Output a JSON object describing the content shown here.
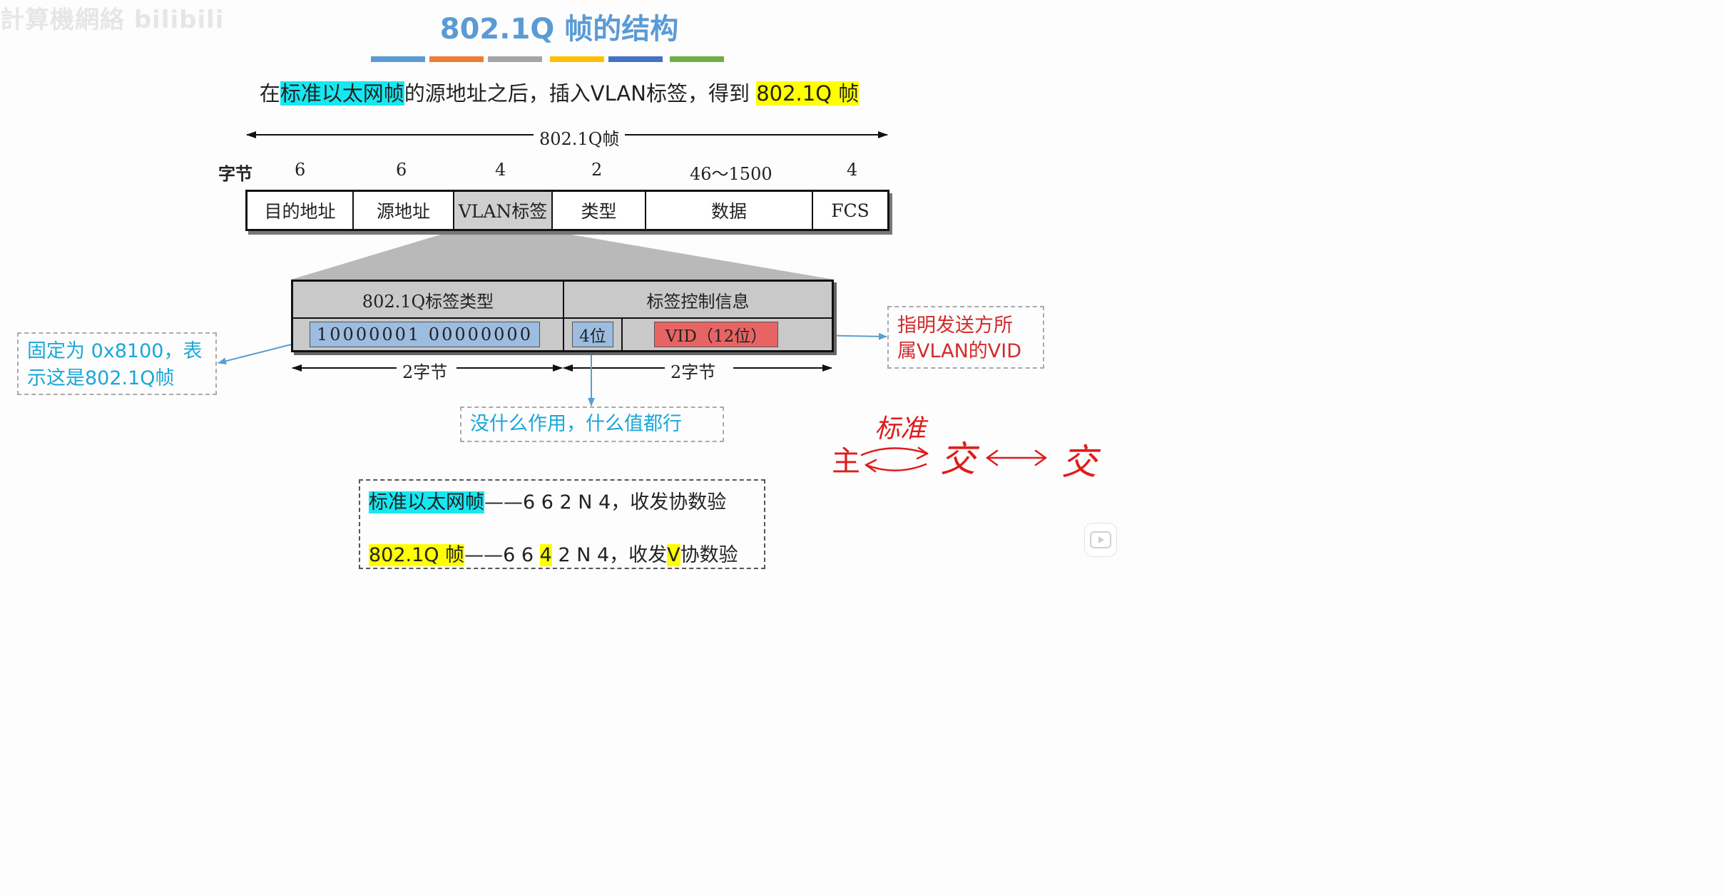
{
  "watermark": "計算機網絡 bilibili",
  "title": "802.1Q 帧的结构",
  "color_bars": [
    "#5b9bd5",
    "#ed7d31",
    "#a5a5a5",
    "#ffc000",
    "#4472c4",
    "#70ad47"
  ],
  "subtitle": {
    "pre": "在",
    "hl1": "标准以太网帧",
    "mid": "的源地址之后，插入VLAN标签，得到",
    "hl2": "802.1Q 帧"
  },
  "frame": {
    "label": "802.1Q帧",
    "bytes_label": "字节",
    "fields": [
      {
        "name": "目的地址",
        "bytes": "6"
      },
      {
        "name": "源地址",
        "bytes": "6"
      },
      {
        "name": "VLAN标签",
        "bytes": "4"
      },
      {
        "name": "类型",
        "bytes": "2"
      },
      {
        "name": "数据",
        "bytes": "46～1500"
      },
      {
        "name": "FCS",
        "bytes": "4"
      }
    ]
  },
  "tag": {
    "type_header": "802.1Q标签类型",
    "tci_header": "标签控制信息",
    "type_bits": "10000001 00000000",
    "pri_bits": "4位",
    "vid": "VID（12位）",
    "left_span": "2字节",
    "right_span": "2字节"
  },
  "notes": {
    "fixed_line1": "固定为 0x8100，表",
    "fixed_line2": "示这是802.1Q帧",
    "vid_line1": "指明发送方所",
    "vid_line2": "属VLAN的VID",
    "useless": "没什么作用，什么值都行"
  },
  "summary": {
    "line1_hl": "标准以太网帧",
    "line1_rest": "——6 6 2 N 4，收发协数验",
    "line2_hl": "802.1Q 帧",
    "line2_a": "——6 6 ",
    "line2_b": "4",
    "line2_c": " 2 N 4，收发",
    "line2_d": "V",
    "line2_e": "协数验"
  },
  "handwriting": {
    "left": "主",
    "top": "标准",
    "mid": "交",
    "right": "交",
    "color": "#e01b1b"
  }
}
